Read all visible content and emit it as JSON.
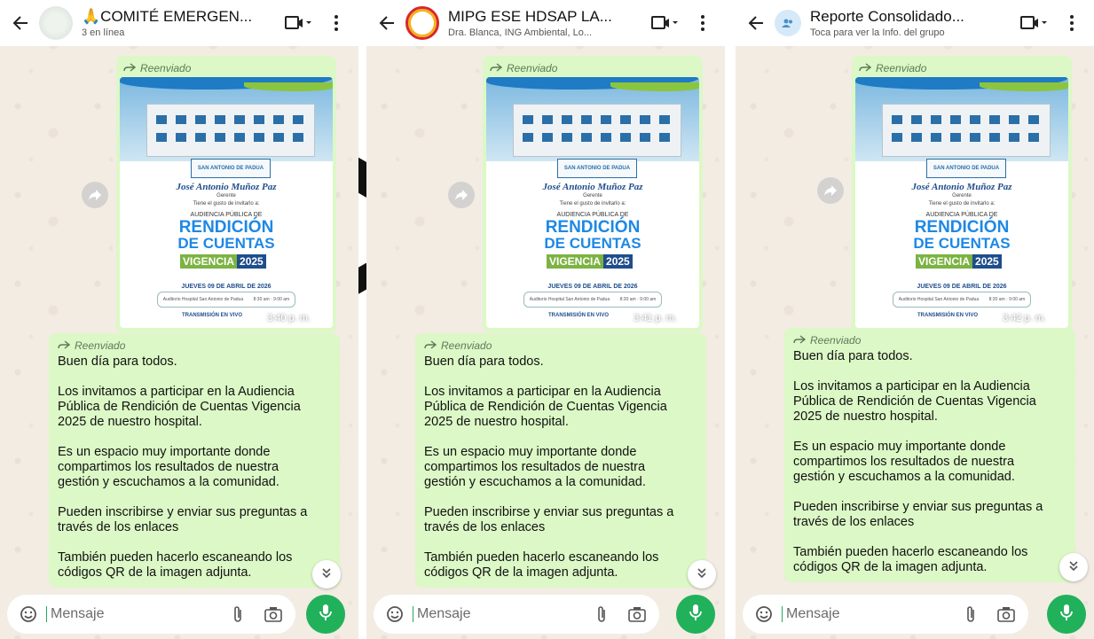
{
  "colors": {
    "bubble": "#dcf8c6",
    "accent": "#21b15a",
    "wallpaper": "#f2ece3"
  },
  "poster": {
    "name": "José Antonio Muñoz Paz",
    "role": "Gerente",
    "invite": "Tiene el gusto de invitarlo a:",
    "audience": "AUDIENCIA PÚBLICA DE",
    "rendicion": "RENDICIÓN",
    "de_cuentas": "DE CUENTAS",
    "vigencia": "VIGENCIA",
    "year": "2025",
    "logo_text": "SAN ANTONIO DE PADUA",
    "date": "JUEVES 09 DE ABRIL DE 2026",
    "place": "Auditorio Hospital San Antonio de Padua",
    "times": "8:30 am · 9:00 am",
    "stream": "TRANSMISIÓN EN VIVO"
  },
  "message": {
    "forwarded_label": "Reenviado",
    "paragraphs": [
      [
        "Buen día para todos."
      ],
      [
        "Los invitamos a participar en la Audiencia",
        "Pública de Rendición de Cuentas Vigencia",
        "2025 de nuestro hospital."
      ],
      [
        "Es un espacio muy importante donde",
        "compartimos los resultados de nuestra",
        "gestión y escuchamos a la comunidad."
      ],
      [
        "Pueden inscribirse y enviar sus preguntas a",
        "través de los enlaces"
      ],
      [
        "También pueden hacerlo escaneando los",
        "códigos QR de la imagen adjunta."
      ]
    ]
  },
  "input": {
    "placeholder": "Mensaje"
  },
  "chats": [
    {
      "title": "🙏COMITÉ EMERGEN...",
      "subtitle": "3 en línea",
      "image_time": "3:40 p. m."
    },
    {
      "title": "MIPG ESE HDSAP LA...",
      "subtitle": "Dra. Blanca, ING Ambiental, Lo...",
      "image_time": "3:41 p. m."
    },
    {
      "title": "Reporte Consolidado...",
      "subtitle": "Toca para ver la Info. del grupo",
      "image_time": "3:42 p. m."
    }
  ]
}
